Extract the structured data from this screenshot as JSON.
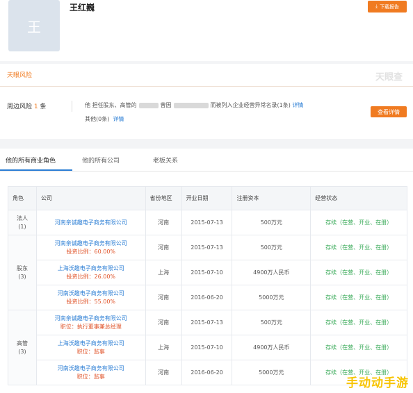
{
  "profile": {
    "avatar_char": "王",
    "name": "王红巍",
    "download_label": "下载报告"
  },
  "risk": {
    "section_tag": "天眼风险",
    "logo_text": "天眼查",
    "label_prefix": "周边风险",
    "count": "1",
    "label_suffix": "条",
    "line1_a": "他 担任股东、高管的",
    "line1_b": "曾因",
    "line1_c": "而被列入企业经营异常名录(1条)",
    "line1_link": "详情",
    "line2_text": "其他(0条)",
    "line2_link": "详情",
    "view_button": "查看详情"
  },
  "tabs": [
    "他的所有商业角色",
    "他的所有公司",
    "老板关系"
  ],
  "table": {
    "headers": [
      "角色",
      "公司",
      "省份地区",
      "开业日期",
      "注册资本",
      "经营状态"
    ],
    "groups": [
      {
        "role": "法人",
        "count": "(1)",
        "rows": [
          {
            "company": "河南亲诚趣电子商务有限公司",
            "sub": "",
            "region": "河南",
            "date": "2015-07-13",
            "capital": "500万元",
            "status": "存续（在营、开业、在册）"
          }
        ]
      },
      {
        "role": "股东",
        "count": "(3)",
        "rows": [
          {
            "company": "河南亲诚趣电子商务有限公司",
            "sub": "投资比例：60.00%",
            "region": "河南",
            "date": "2015-07-13",
            "capital": "500万元",
            "status": "存续（在营、开业、在册）"
          },
          {
            "company": "上海沃趣电子商务有限公司",
            "sub": "投资比例：26.00%",
            "region": "上海",
            "date": "2015-07-10",
            "capital": "4900万人民币",
            "status": "存续（在营、开业、在册）"
          },
          {
            "company": "河南沃趣电子商务有限公司",
            "sub": "投资比例：55.00%",
            "region": "河南",
            "date": "2016-06-20",
            "capital": "5000万元",
            "status": "存续（在营、开业、在册）"
          }
        ]
      },
      {
        "role": "高管",
        "count": "(3)",
        "rows": [
          {
            "company": "河南亲诚趣电子商务有限公司",
            "sub": "职位：执行董事兼总经理",
            "region": "河南",
            "date": "2015-07-13",
            "capital": "500万元",
            "status": "存续（在营、开业、在册）"
          },
          {
            "company": "上海沃趣电子商务有限公司",
            "sub": "职位：监事",
            "region": "上海",
            "date": "2015-07-10",
            "capital": "4900万人民币",
            "status": "存续（在营、开业、在册）"
          },
          {
            "company": "河南沃趣电子商务有限公司",
            "sub": "职位：监事",
            "region": "河南",
            "date": "2016-06-20",
            "capital": "5000万元",
            "status": "存续（在营、开业、在册）"
          }
        ]
      }
    ]
  },
  "watermark": "手动动手游",
  "colors": {
    "accent": "#f07b21",
    "link": "#2a7dd4",
    "status": "#3bab5a",
    "sub_red": "#e0552b"
  }
}
